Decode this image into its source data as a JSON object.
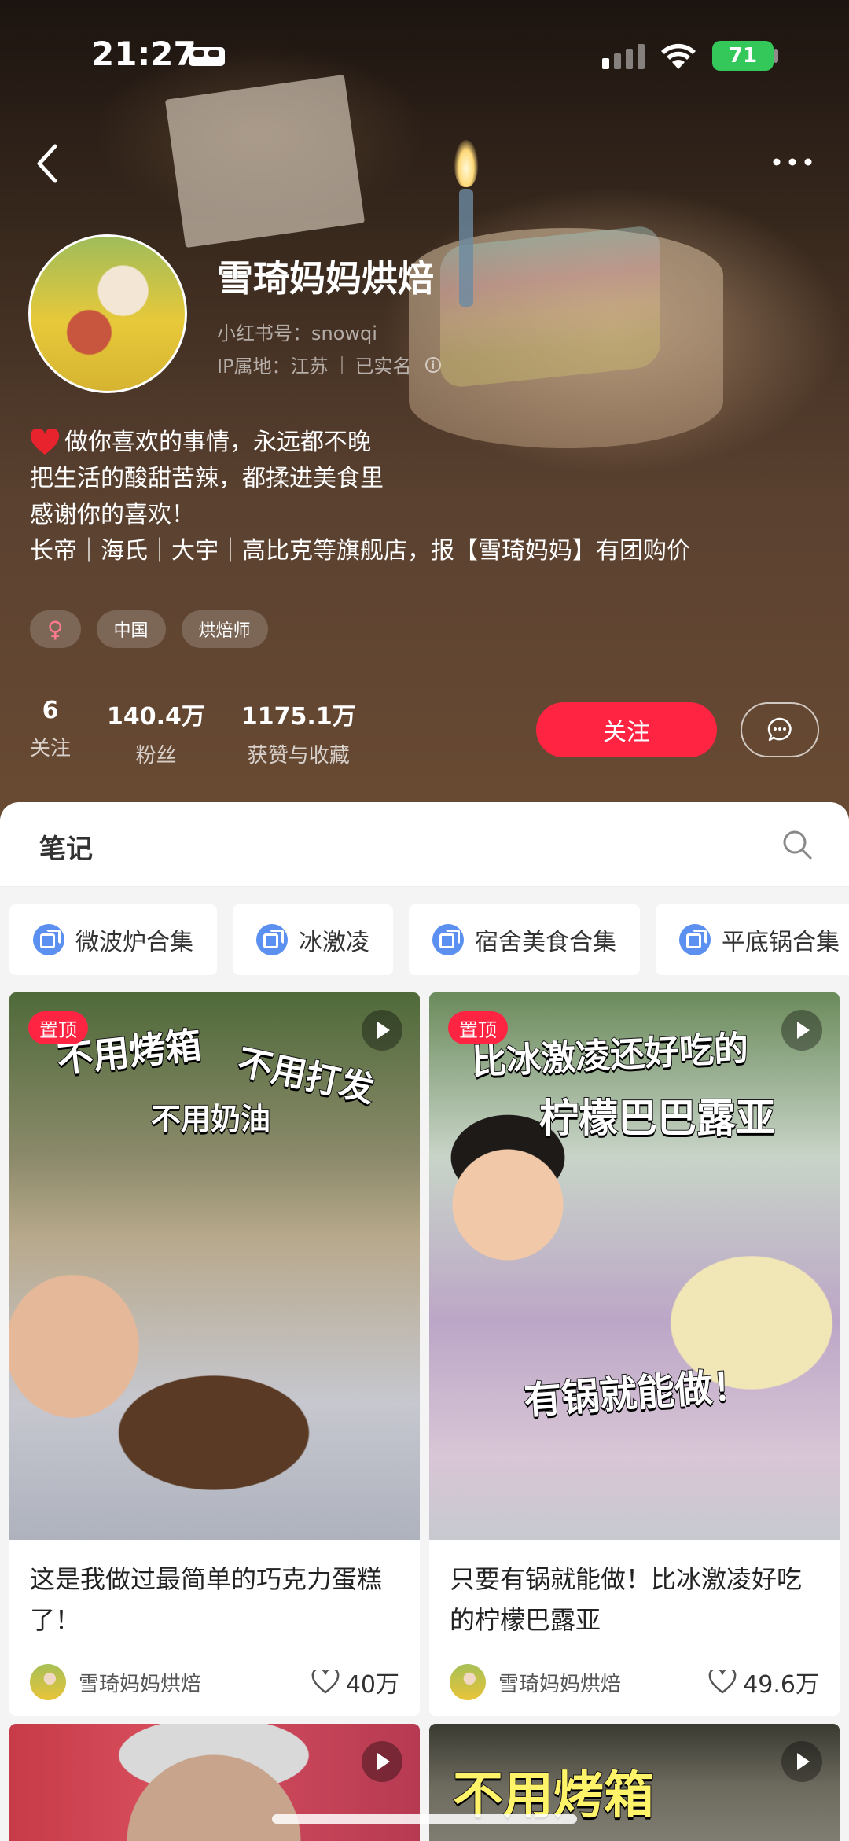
{
  "status_bar": {
    "time": "21:27",
    "battery": "71"
  },
  "profile": {
    "nickname": "雪琦妈妈烘焙",
    "red_id": "小红书号：snowqi",
    "ip_location": "IP属地：江苏",
    "verified": "已实名",
    "bio_lines": [
      "做你喜欢的事情，永远都不晚",
      "把生活的酸甜苦辣，都揉进美食里",
      "感谢你的喜欢！",
      "长帝｜海氏｜大宇｜高比克等旗舰店，报【雪琦妈妈】有团购价"
    ],
    "tags": [
      "♀",
      "中国",
      "烘焙师"
    ],
    "stats": [
      {
        "value": "6",
        "label": "关注"
      },
      {
        "value": "140.4万",
        "label": "粉丝"
      },
      {
        "value": "1175.1万",
        "label": "获赞与收藏"
      }
    ],
    "follow_label": "关注"
  },
  "notes_tab": {
    "label": "笔记"
  },
  "collections": [
    "微波炉合集",
    "冰激凌",
    "宿舍美食合集",
    "平底锅合集"
  ],
  "cards": [
    {
      "badge": "置顶",
      "overlay": [
        "不用烤箱",
        "不用打发",
        "不用奶油"
      ],
      "title": "这是我做过最简单的巧克力蛋糕了！",
      "author": "雪琦妈妈烘焙",
      "likes": "40万"
    },
    {
      "badge": "置顶",
      "overlay": [
        "比冰激凌还好吃的",
        "柠檬巴巴露亚",
        "有锅就能做！"
      ],
      "title": "只要有锅就能做！比冰激凌好吃的柠檬巴露亚",
      "author": "雪琦妈妈烘焙",
      "likes": "49.6万"
    },
    {
      "overlay": []
    },
    {
      "overlay": [
        "不用烤箱"
      ]
    }
  ],
  "colors": {
    "accent": "#ff2442",
    "collection_icon": "#5b8ff0",
    "battery": "#34c759"
  }
}
